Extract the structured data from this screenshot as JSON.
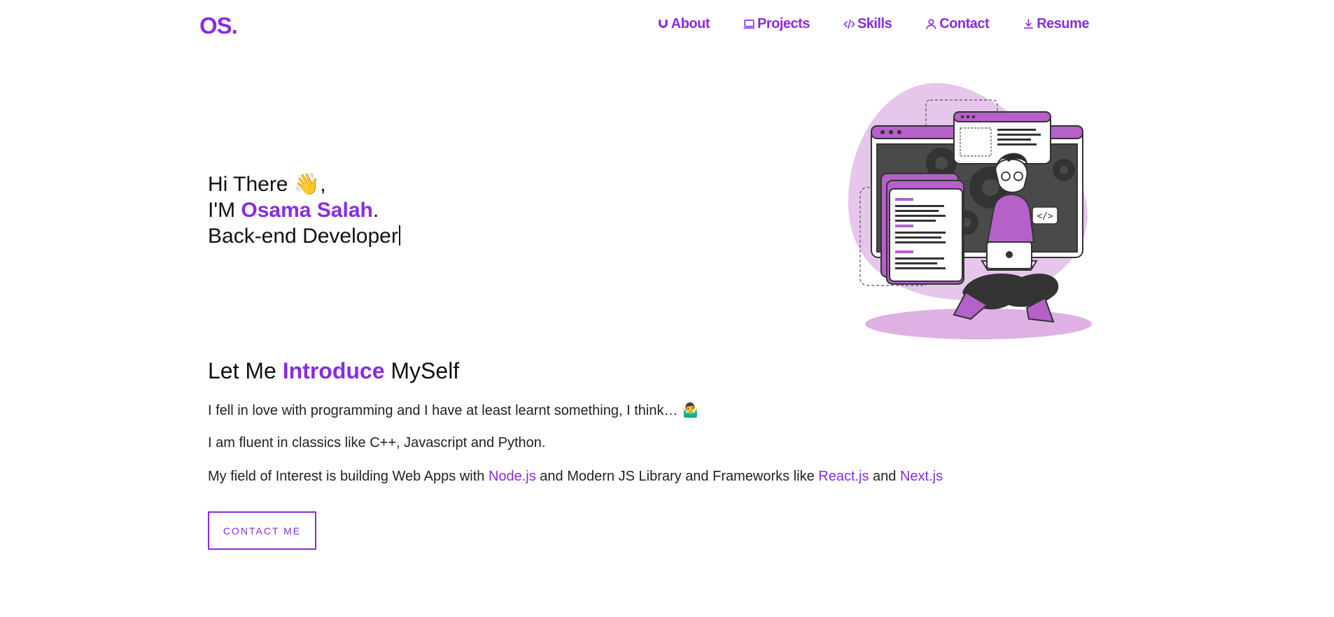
{
  "logo": "OS.",
  "nav": [
    {
      "label": "About",
      "icon": "magnet-icon"
    },
    {
      "label": "Projects",
      "icon": "laptop-icon"
    },
    {
      "label": "Skills",
      "icon": "code-icon"
    },
    {
      "label": "Contact",
      "icon": "user-icon"
    },
    {
      "label": "Resume",
      "icon": "download-icon"
    }
  ],
  "hero": {
    "greeting": "Hi There",
    "wave_emoji": "👋",
    "greeting_suffix": ",",
    "im_prefix": "I'M ",
    "name": "Osama Salah",
    "name_suffix": ".",
    "role": "Back-end Developer"
  },
  "intro": {
    "title_start": "Let Me ",
    "title_accent": "Introduce",
    "title_end": " MySelf",
    "p1": "I fell in love with programming and I have at least learnt something, I think… 🤷‍♂️",
    "p2": "I am fluent in classics like C++, Javascript and Python.",
    "p3_start": "My field of Interest is building Web Apps with ",
    "p3_link1": "Node.js",
    "p3_mid": " and Modern JS Library and Frameworks like ",
    "p3_link2": "React.js",
    "p3_and": " and ",
    "p3_link3": "Next.js"
  },
  "contact_button": "CONTACT ME",
  "colors": {
    "accent": "#8a2be2",
    "illustration_purple": "#b561c9",
    "illustration_light": "#e6c6eb"
  }
}
